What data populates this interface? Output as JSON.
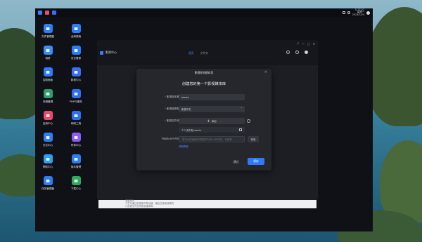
{
  "desktop": {
    "clock": [
      "5:17:22",
      "星期一",
      "2023/7/24"
    ],
    "icons": [
      {
        "label": "文件管理器",
        "icon": "folder-icon",
        "color": "#2d7df6"
      },
      {
        "label": "全局搜索",
        "icon": "search-icon",
        "color": "#2d7df6"
      },
      {
        "label": "相册",
        "icon": "photo-icon",
        "color": "#3a8ef6"
      },
      {
        "label": "安全管家",
        "icon": "shield-icon",
        "color": "#2d7df6"
      },
      {
        "label": "控制面板",
        "icon": "control-panel-icon",
        "color": "#2d7df6"
      },
      {
        "label": "影视中心",
        "icon": "media-icon",
        "color": "#3b6ff0"
      },
      {
        "label": "存储管理",
        "icon": "storage-icon",
        "color": "#2e9e6e"
      },
      {
        "label": "PHP与服务",
        "icon": "server-icon",
        "color": "#2e6ef0"
      },
      {
        "label": "应用中心",
        "icon": "app-center-icon",
        "color": "#e84a6a"
      },
      {
        "label": "网络工具",
        "icon": "network-icon",
        "color": "#2e6ef0"
      },
      {
        "label": "日志中心",
        "icon": "log-icon",
        "color": "#2d7df6"
      },
      {
        "label": "时钟中心",
        "icon": "clock-icon",
        "color": "#8c5cf6"
      },
      {
        "label": "帮助中心",
        "icon": "help-icon",
        "color": "#2d9df6"
      },
      {
        "label": "版本管理",
        "icon": "version-icon",
        "color": "#2d7df6"
      },
      {
        "label": "任务管理器",
        "icon": "task-manager-icon",
        "color": "#2d7df6"
      },
      {
        "label": "下载中心",
        "icon": "download-icon",
        "color": "#2eaa5c"
      }
    ]
  },
  "window": {
    "title": "影视中心",
    "tabs": [
      "首页",
      "文件夹"
    ],
    "footnote": [
      "温馨提示",
      "1.您可通过影视库向导创建，建议在使用设置前",
      "2.如需文件夹关联到媒体库"
    ]
  },
  "dialog": {
    "title": "影视库创建向导",
    "heading": "创建您的第一个影视媒体库",
    "fields": {
      "name_label": "影视库名称",
      "name_value": "movie",
      "type_label": "影视库类型",
      "type_value": "影视中文",
      "folder_label": "影视文件夹",
      "folder_add": "添加",
      "folder_path": "个人文件夹/movie",
      "api_label": "TMDB API 许可",
      "api_placeholder": "您可以在官网申请您的TMDB API许可，可参考",
      "verify_label": "校验",
      "link_text": "获取教程"
    },
    "cancel_label": "跳过",
    "save_label": "保存"
  }
}
